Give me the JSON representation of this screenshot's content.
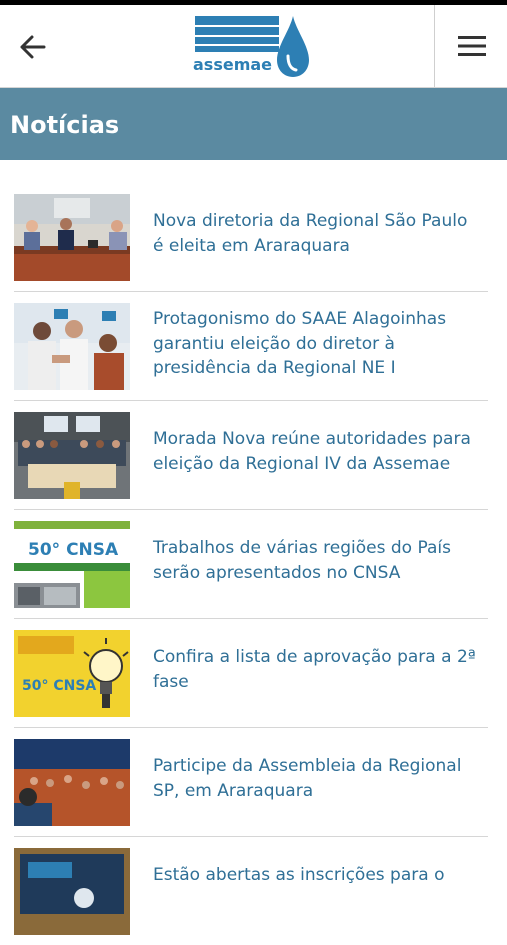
{
  "header": {
    "back_icon": "arrow-left-icon",
    "menu_icon": "hamburger-menu-icon",
    "logo_text": "assemae",
    "brand_color": "#2d7fb4"
  },
  "section": {
    "title": "Notícias",
    "bar_color": "#5b8aa1"
  },
  "news": [
    {
      "title": "Nova diretoria da Regional São Paulo é eleita em Araraquara",
      "thumb": "meeting-table-photo"
    },
    {
      "title": "Protagonismo do SAAE Alagoinhas garantiu eleição do diretor à presidência da Regional NE I",
      "thumb": "handshake-photo"
    },
    {
      "title": "Morada Nova reúne autoridades para eleição da Regional IV da Assemae",
      "thumb": "group-event-photo"
    },
    {
      "title": "Trabalhos de várias regiões do País serão apresentados no CNSA",
      "thumb": "cnsa-banner-image",
      "thumb_text": "50° CNSA"
    },
    {
      "title": "Confira a lista de aprovação para a 2ª fase",
      "thumb": "award-lightbulb-image",
      "thumb_text": "50° CNSA"
    },
    {
      "title": "Participe da Assembleia da Regional SP, em Araraquara",
      "thumb": "auditorium-photo"
    },
    {
      "title": "Estão abertas as inscrições para o",
      "thumb": "presentation-screen-photo"
    }
  ]
}
